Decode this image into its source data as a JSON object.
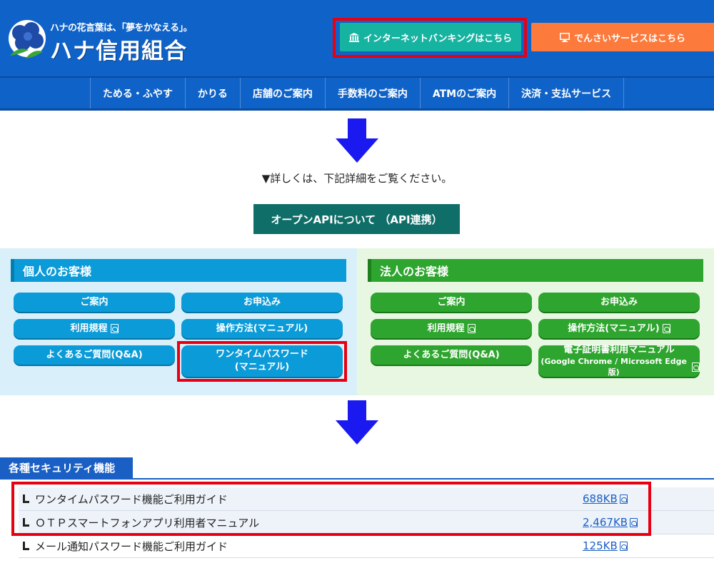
{
  "header": {
    "tagline": "ハナの花言葉は、「夢をかなえる」。",
    "logo_name": "ハナ信用組合",
    "internet_banking_label": "インターネットバンキングはこちら",
    "densai_label": "でんさいサービスはこちら"
  },
  "nav": {
    "items": [
      {
        "label": "ためる・ふやす"
      },
      {
        "label": "かりる"
      },
      {
        "label": "店舗のご案内"
      },
      {
        "label": "手数料のご案内"
      },
      {
        "label": "ATMのご案内"
      },
      {
        "label": "決済・支払サービス"
      }
    ]
  },
  "notice": "▼詳しくは、下記詳細をご覧ください。",
  "api_button_label": "オープンAPIについて （API連携）",
  "personal": {
    "title": "個人のお客様",
    "guide": "ご案内",
    "apply": "お申込み",
    "terms": "利用規程",
    "manual": "操作方法(マニュアル)",
    "faq": "よくあるご質問(Q&A)",
    "otp_line1": "ワンタイムパスワード",
    "otp_line2": "(マニュアル)"
  },
  "corporate": {
    "title": "法人のお客様",
    "guide": "ご案内",
    "apply": "お申込み",
    "terms": "利用規程",
    "manual": "操作方法(マニュアル)",
    "faq": "よくあるご質問(Q&A)",
    "cert_line1": "電子証明書利用マニュアル",
    "cert_line2": "(Google Chrome / Microsoft Edge版)"
  },
  "security": {
    "title": "各種セキュリティ機能",
    "docs": [
      {
        "title": "ワンタイムパスワード機能ご利用ガイド",
        "size": "688KB"
      },
      {
        "title": "ＯＴＰスマートフォンアプリ利用者マニュアル",
        "size": "2,467KB"
      },
      {
        "title": "メール通知パスワード機能ご利用ガイド",
        "size": "125KB"
      }
    ]
  },
  "colors": {
    "header_blue": "#0f63c8",
    "internet_banking_teal": "#17b3a1",
    "densai_orange": "#fb7a3c",
    "personal_blue": "#0b9bd8",
    "corporate_green": "#2ea52e",
    "highlight_red": "#e60012",
    "arrow_blue": "#1a1af0"
  }
}
